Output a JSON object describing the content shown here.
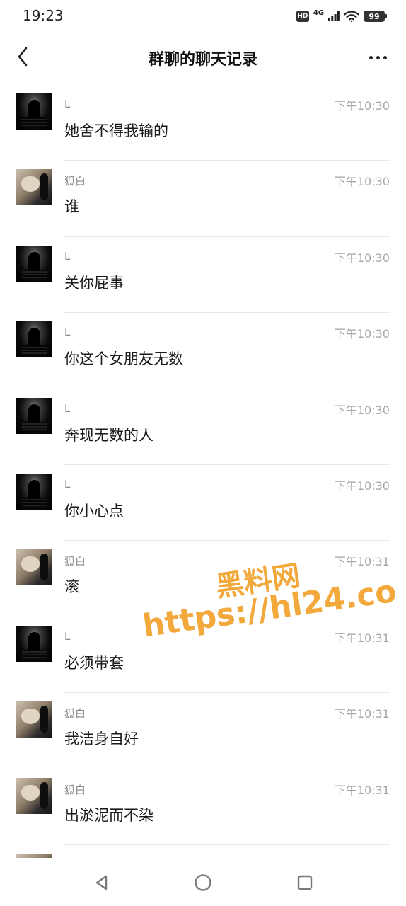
{
  "status_bar": {
    "time": "19:23",
    "hd": "HD",
    "network": "4G",
    "battery": "99"
  },
  "header": {
    "title": "群聊的聊天记录",
    "back_icon": "chevron-left-icon",
    "more_icon": "more-dots-icon"
  },
  "messages": [
    {
      "sender": "L",
      "time": "下午10:30",
      "text": "她舍不得我输的",
      "avatar": "dark"
    },
    {
      "sender": "狐白",
      "time": "下午10:30",
      "text": "谁",
      "avatar": "cat"
    },
    {
      "sender": "L",
      "time": "下午10:30",
      "text": "关你屁事",
      "avatar": "dark"
    },
    {
      "sender": "L",
      "time": "下午10:30",
      "text": "你这个女朋友无数",
      "avatar": "dark"
    },
    {
      "sender": "L",
      "time": "下午10:30",
      "text": "奔现无数的人",
      "avatar": "dark"
    },
    {
      "sender": "L",
      "time": "下午10:30",
      "text": "你小心点",
      "avatar": "dark"
    },
    {
      "sender": "狐白",
      "time": "下午10:31",
      "text": "滚",
      "avatar": "cat"
    },
    {
      "sender": "L",
      "time": "下午10:31",
      "text": "必须带套",
      "avatar": "dark"
    },
    {
      "sender": "狐白",
      "time": "下午10:31",
      "text": "我洁身自好",
      "avatar": "cat"
    },
    {
      "sender": "狐白",
      "time": "下午10:31",
      "text": "出淤泥而不染",
      "avatar": "cat"
    },
    {
      "sender": "",
      "time": "",
      "text": "",
      "avatar": "cat"
    }
  ],
  "watermark": {
    "title": "黑料网",
    "url": "https://hl24.co",
    "color": "#f2a83a"
  },
  "system_nav": {
    "back_icon": "triangle-back-icon",
    "home_icon": "circle-home-icon",
    "recents_icon": "square-recents-icon"
  }
}
